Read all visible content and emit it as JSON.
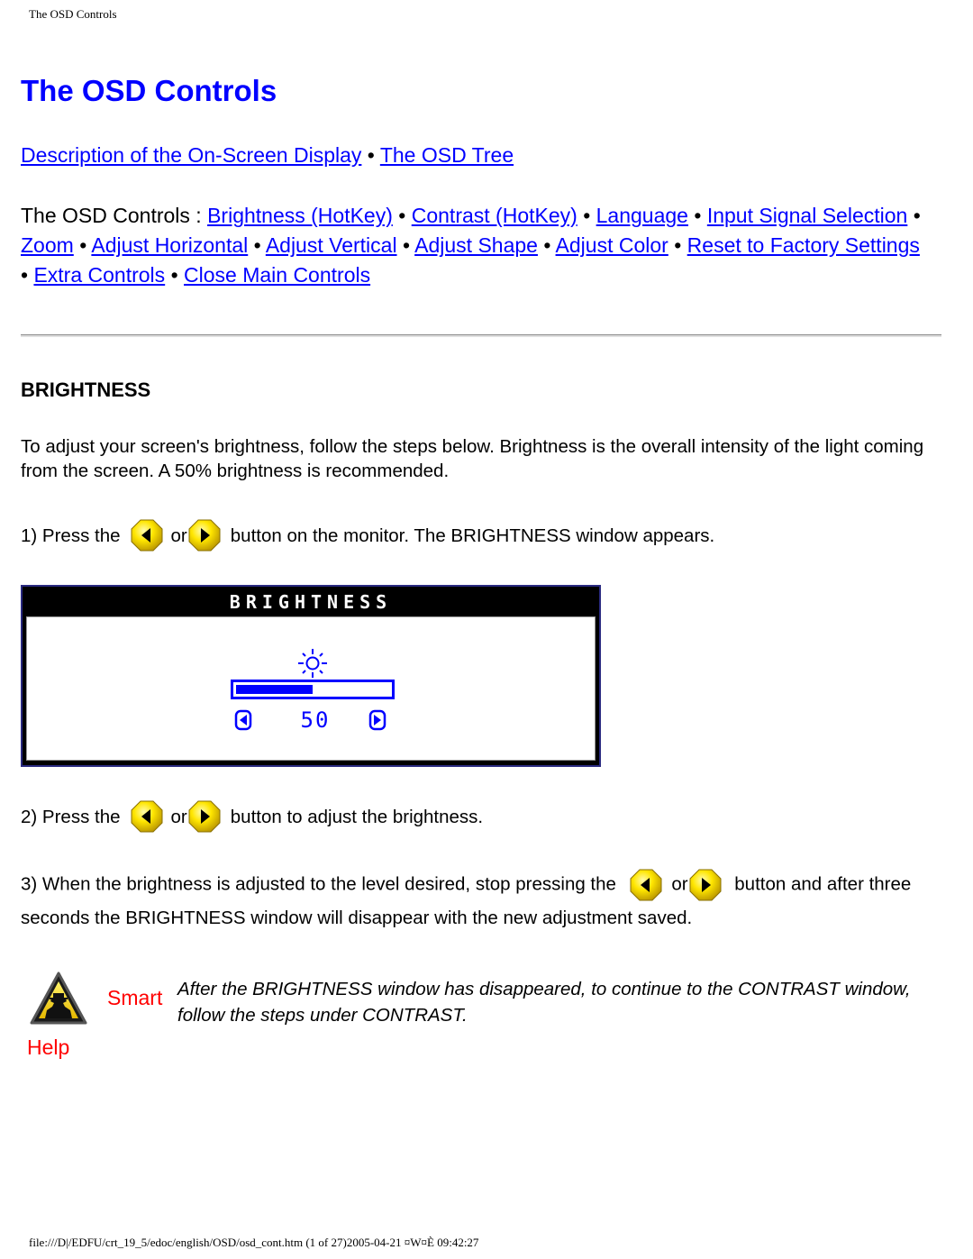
{
  "header": {
    "running_title": "The OSD Controls"
  },
  "page": {
    "title": "The OSD Controls"
  },
  "nav_top": {
    "links": [
      "Description of the On-Screen Display",
      "The OSD Tree"
    ],
    "separator": "•"
  },
  "nav_controls": {
    "prefix": "The OSD Controls : ",
    "links": [
      "Brightness (HotKey)",
      "Contrast (HotKey)",
      "Language",
      "Input Signal Selection",
      "Zoom",
      "Adjust Horizontal",
      "Adjust Vertical",
      "Adjust Shape",
      "Adjust Color",
      "Reset to Factory Settings",
      "Extra Controls",
      "Close Main Controls"
    ],
    "separator": "•"
  },
  "section": {
    "heading": "BRIGHTNESS",
    "intro": "To adjust your screen's brightness, follow the steps below. Brightness is the overall intensity of the light coming from the screen. A 50% brightness is recommended.",
    "step1": {
      "before": "1) Press the",
      "or": "or",
      "after": "button on the monitor. The BRIGHTNESS window appears."
    },
    "step2": {
      "before": "2) Press the",
      "or": "or",
      "after": "button to adjust the brightness."
    },
    "step3": {
      "before": "3) When the brightness is adjusted to the level desired, stop pressing the",
      "or": "or",
      "after": "button and after three seconds the BRIGHTNESS window will disappear with the new adjustment saved."
    },
    "icons": {
      "left_button": "left-arrow-button-icon",
      "right_button": "right-arrow-button-icon"
    }
  },
  "osd_window": {
    "title": "BRIGHTNESS",
    "icon": "sun-icon",
    "value": "50",
    "level_fraction": 0.5,
    "accent_color": "#0000ff"
  },
  "smart_help": {
    "label_smart": "Smart",
    "label_help": "Help",
    "text": "After the BRIGHTNESS window has disappeared, to continue to the CONTRAST window, follow the steps under CONTRAST.",
    "label_color": "#ff0000"
  },
  "footer": {
    "path": "file:///D|/EDFU/crt_19_5/edoc/english/OSD/osd_cont.htm (1 of 27)2005-04-21 ¤W¤È 09:42:27"
  },
  "colors": {
    "link": "#0000ff",
    "title": "#0000ff",
    "text": "#000000"
  }
}
